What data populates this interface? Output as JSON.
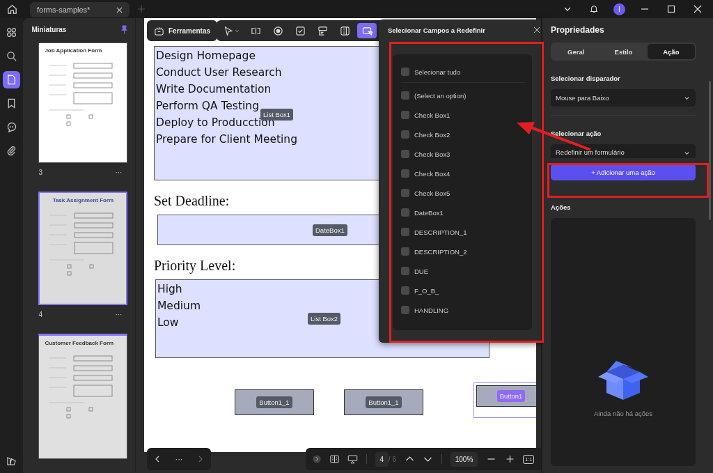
{
  "tab_bar": {
    "tabs": [
      {
        "label": "forms-samples*",
        "selected": true
      }
    ]
  },
  "user": {
    "avatar_initial": "I"
  },
  "sidebar": {
    "items": [
      {
        "kind": "apps",
        "selected": false
      },
      {
        "kind": "search",
        "selected": false
      },
      {
        "kind": "pages",
        "selected": true
      },
      {
        "kind": "bookmark",
        "selected": false
      },
      {
        "kind": "comment",
        "selected": false
      },
      {
        "kind": "attachment",
        "selected": false
      }
    ]
  },
  "thumbnails": {
    "title": "Miniaturas",
    "pinned": true,
    "pages": [
      {
        "number": "3",
        "menu": "···",
        "title": "Job Application Form",
        "selected": false
      },
      {
        "number": "4",
        "menu": "···",
        "title": "Task Assignment Form",
        "selected": true
      },
      {
        "title": "Customer Feedback Form",
        "selected": false
      }
    ]
  },
  "toolbar": {
    "tools_label": "Ferramentas",
    "tools": [
      {
        "kind": "select",
        "selected": false
      },
      {
        "kind": "text-field",
        "selected": false
      },
      {
        "kind": "radio",
        "selected": false
      },
      {
        "kind": "checkbox",
        "selected": false
      },
      {
        "kind": "combo-box",
        "selected": false
      },
      {
        "kind": "list-box",
        "selected": false
      },
      {
        "kind": "button",
        "selected": true
      }
    ]
  },
  "document": {
    "list_box_1": {
      "items": [
        "Design Homepage",
        "Conduct User Research",
        "Write Documentation",
        "Perform QA Testing",
        "Deploy to Producction",
        "Prepare for Client Meeting"
      ],
      "tag": "List Box1"
    },
    "deadline_label": "Set Deadline:",
    "date_field": {
      "tag": "DateBox1"
    },
    "priority_label": "Priority Level:",
    "list_box_2": {
      "items": [
        "High",
        "Medium",
        "Low"
      ],
      "tag": "List Box2"
    },
    "buttons": [
      {
        "tag": "Button1_1",
        "selected": false
      },
      {
        "tag": "Button1_1",
        "selected": false
      },
      {
        "tag": "Button1",
        "selected": true
      }
    ]
  },
  "dialog": {
    "title": "Selecionar Campos a Redefinir",
    "select_all": {
      "label": "Selecionar tudo",
      "checked": false
    },
    "fields": [
      {
        "label": "(Select an option)",
        "checked": false
      },
      {
        "label": "Check Box1",
        "checked": false
      },
      {
        "label": "Check Box2",
        "checked": false
      },
      {
        "label": "Check Box3",
        "checked": false
      },
      {
        "label": "Check Box4",
        "checked": false
      },
      {
        "label": "Check Box5",
        "checked": false
      },
      {
        "label": "DateBox1",
        "checked": false
      },
      {
        "label": "DESCRIPTION_1",
        "checked": false
      },
      {
        "label": "DESCRIPTION_2",
        "checked": false
      },
      {
        "label": "DUE",
        "checked": false
      },
      {
        "label": "F_O_B_",
        "checked": false
      },
      {
        "label": "HANDLING",
        "checked": false
      }
    ]
  },
  "properties": {
    "title": "Propriedades",
    "tabs": [
      {
        "label": "Geral",
        "selected": false
      },
      {
        "label": "Estilo",
        "selected": false
      },
      {
        "label": "Ação",
        "selected": true
      }
    ],
    "trigger_label": "Selecionar disparador",
    "trigger": "Mouse para Baixo",
    "action_label": "Selecionar ação",
    "action": "Redefinir um formulário",
    "add_button": "+ Adicionar uma ação",
    "actions_label": "Ações",
    "empty_text": "Ainda não há ações"
  },
  "bottom_bar": {
    "more": "···",
    "page": "4",
    "page_total": "/ 6",
    "zoom": "100%",
    "zoom_reset": "1:1"
  }
}
